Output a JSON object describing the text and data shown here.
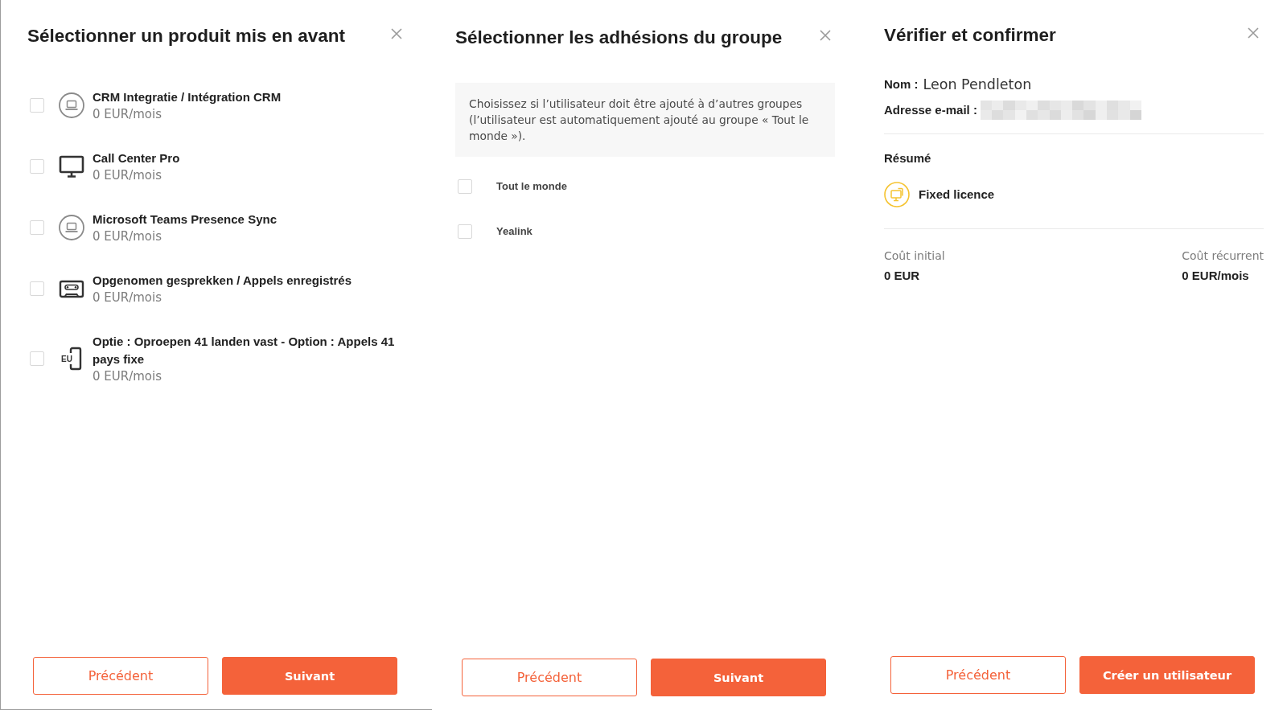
{
  "product_panel": {
    "title": "Sélectionner un produit mis en avant",
    "products": [
      {
        "name": "CRM Integratie / Intégration CRM",
        "price": "0 EUR/mois",
        "kind": "laptop-circle",
        "checked": false
      },
      {
        "name": "Call Center Pro",
        "price": "0 EUR/mois",
        "kind": "monitor",
        "checked": false
      },
      {
        "name": "Microsoft Teams Presence Sync",
        "price": "0 EUR/mois",
        "kind": "laptop-circle",
        "checked": false
      },
      {
        "name": "Opgenomen gesprekken / Appels enregistrés",
        "price": "0 EUR/mois",
        "kind": "cassette",
        "checked": false
      },
      {
        "name": "Optie : Oproepen 41 landen vast - Option : Appels 41 pays fixe",
        "price": "0 EUR/mois",
        "kind": "phone-badge",
        "icon_text": "EU",
        "checked": false
      }
    ],
    "buttons": [
      {
        "label": "Précédent",
        "kind": "secondary"
      },
      {
        "label": "Suivant",
        "kind": "primary"
      }
    ]
  },
  "group_panel": {
    "title": "Sélectionner les adhésions du groupe",
    "info": "Choisissez si l’utilisateur doit être ajouté à d’autres groupes (l’utilisateur est automatiquement ajouté au groupe « Tout le monde »).",
    "groups": [
      {
        "label": "Tout le monde",
        "checked": false
      },
      {
        "label": "Yealink",
        "checked": false
      }
    ],
    "buttons": [
      {
        "label": "Précédent",
        "kind": "secondary"
      },
      {
        "label": "Suivant",
        "kind": "primary"
      }
    ]
  },
  "review_panel": {
    "title": "Vérifier et confirmer",
    "name": {
      "label": "Nom :",
      "value": "Leon Pendleton"
    },
    "email": {
      "label": "Adresse e-mail :",
      "redacted": true
    },
    "summary_title": "Résumé",
    "licence": "Fixed licence",
    "costs": [
      {
        "label": "Coût initial",
        "value": "0 EUR"
      },
      {
        "label": "Coût récurrent",
        "value": "0 EUR/mois"
      }
    ],
    "buttons": [
      {
        "label": "Précédent",
        "kind": "secondary"
      },
      {
        "label": "Créer un utilisateur",
        "kind": "primary"
      }
    ]
  }
}
